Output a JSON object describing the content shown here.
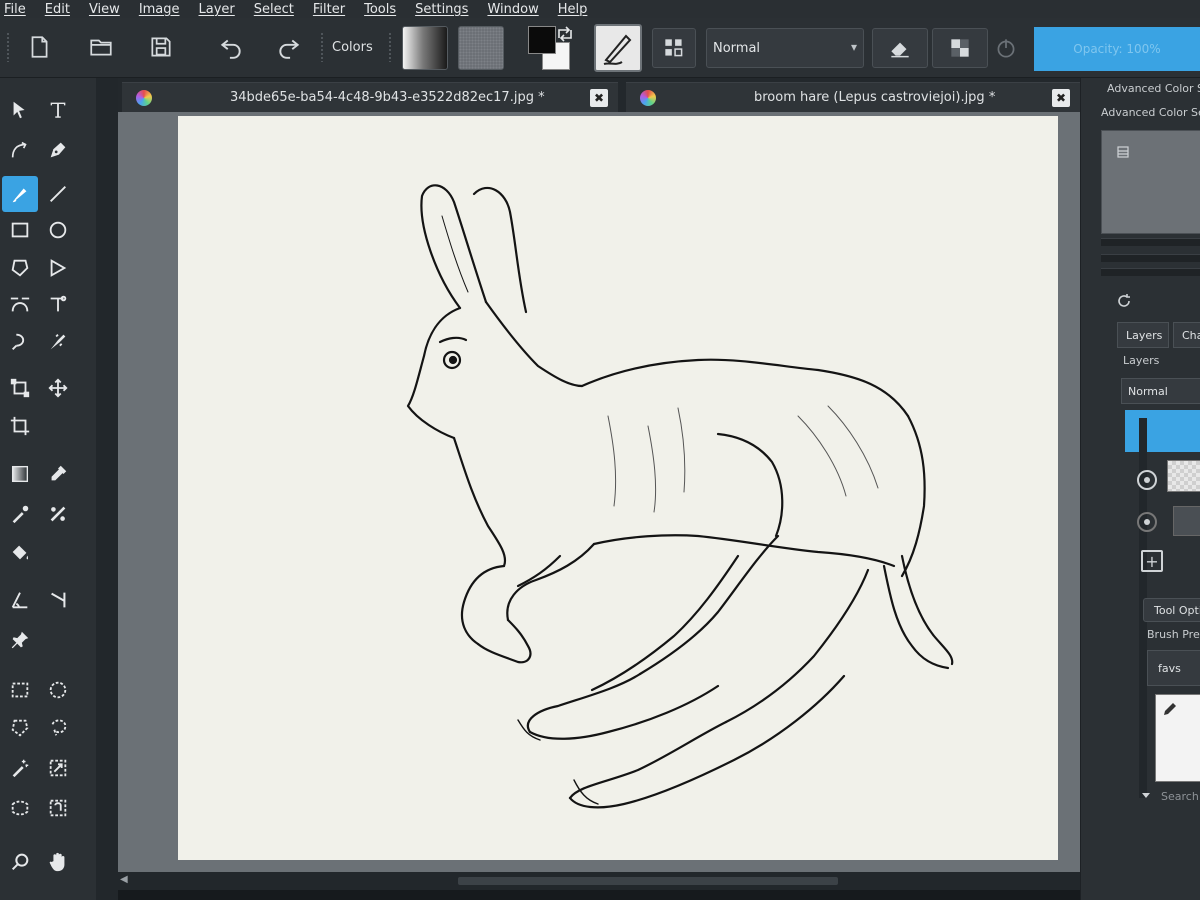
{
  "menubar": {
    "items": [
      "File",
      "Edit",
      "View",
      "Image",
      "Layer",
      "Select",
      "Filter",
      "Tools",
      "Settings",
      "Window",
      "Help"
    ]
  },
  "toolbar": {
    "new_icon": "new-document-icon",
    "open_icon": "folder-icon",
    "save_icon": "save-icon",
    "undo_icon": "undo-icon",
    "redo_icon": "redo-icon",
    "colors_label": "Colors",
    "blend_mode": "Normal",
    "opacity_label": "Opacity: 100%",
    "accent_color": "#3aa3e3"
  },
  "tabs": [
    {
      "title": "34bde65e-ba54-4c48-9b43-e3522d82ec17.jpg *",
      "close": "✖"
    },
    {
      "title": "broom hare (Lepus castroviejoi).jpg *",
      "close": "✖"
    }
  ],
  "docker": {
    "advanced_color_title": "Advanced Color Selector",
    "advanced_color_subtitle": "Advanced Color Selector",
    "tab_layers": "Layers",
    "tab_channels": "Channels",
    "layers_heading": "Layers",
    "layer_blend": "Normal",
    "tool_options": "Tool Options",
    "brush_presets": "Brush Presets",
    "brush_tag": "favs",
    "search_placeholder": "Search"
  }
}
